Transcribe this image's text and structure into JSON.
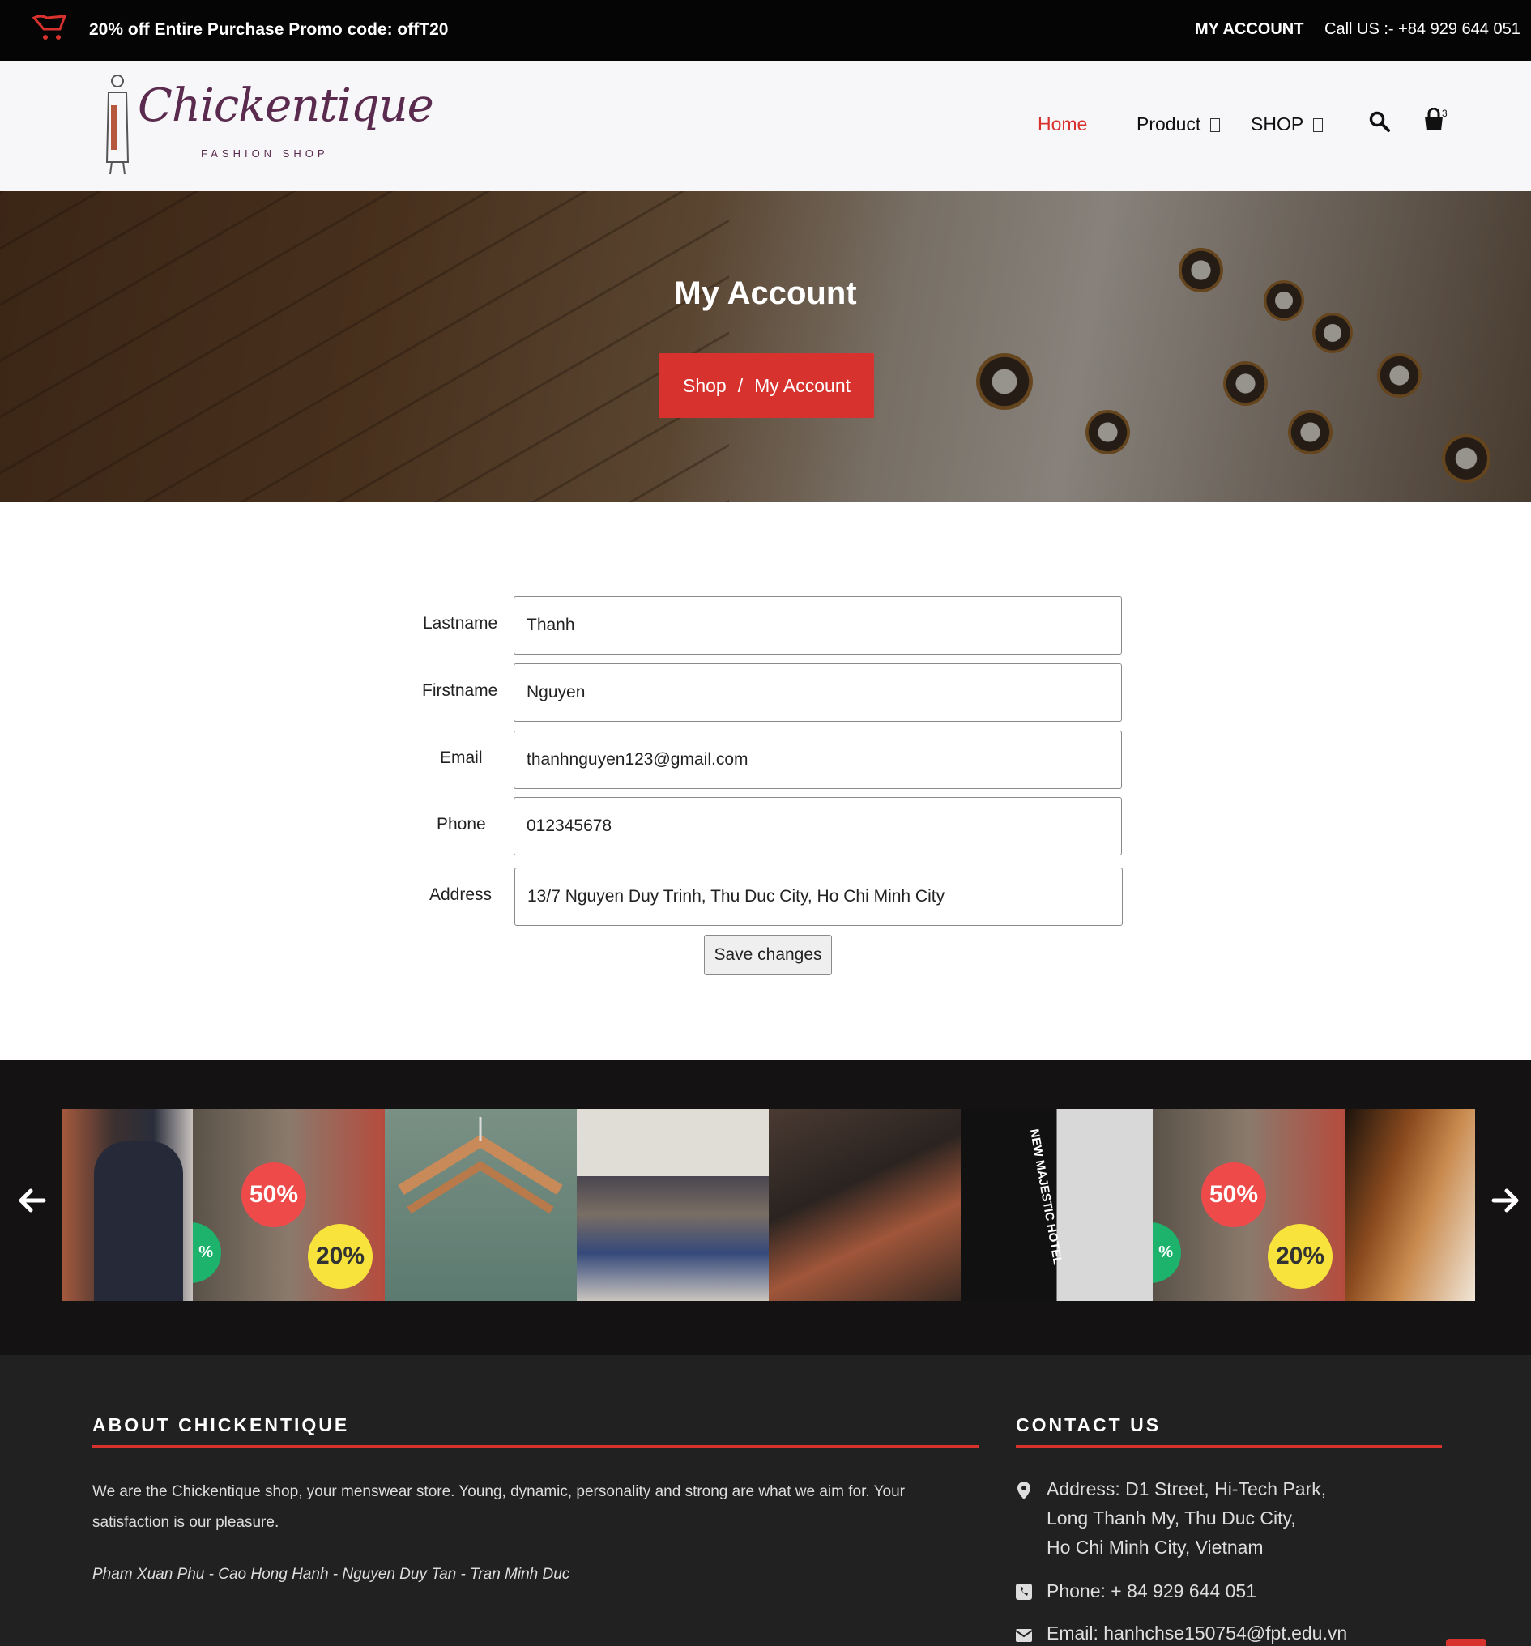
{
  "topbar": {
    "promo": "20% off Entire Purchase Promo code: offT20",
    "my_account": "MY ACCOUNT",
    "call": "Call US :- +84 929 644 051"
  },
  "header": {
    "logo_text": "Chickentique",
    "logo_sub": "FASHION SHOP",
    "nav": {
      "home": "Home",
      "product": "Product",
      "shop": "SHOP"
    },
    "cart_count": "3"
  },
  "banner": {
    "title": "My Account",
    "breadcrumb": {
      "shop": "Shop",
      "separator": "/",
      "current": "My Account"
    }
  },
  "form": {
    "lastname": {
      "label": "Lastname",
      "value": "Thanh"
    },
    "firstname": {
      "label": "Firstname",
      "value": "Nguyen"
    },
    "email": {
      "label": "Email",
      "value": "thanhnguyen123@gmail.com"
    },
    "phone": {
      "label": "Phone",
      "value": "012345678"
    },
    "address": {
      "label": "Address",
      "value": "13/7 Nguyen Duy Trinh, Thu Duc City, Ho Chi Minh City"
    },
    "save_label": "Save changes"
  },
  "carousel": {
    "badge_50": "50%",
    "badge_20": "20%",
    "badge_partial": "%",
    "bag_text": "NEW MAJESTIC HOTEL"
  },
  "footer": {
    "about_title": "ABOUT CHICKENTIQUE",
    "about_text": "We are the Chickentique shop, your menswear store. Young, dynamic, personality and strong are what we aim for. Your satisfaction is our pleasure.",
    "team": "Pham Xuan Phu - Cao Hong Hanh - Nguyen Duy Tan - Tran Minh Duc",
    "contact_title": "CONTACT US",
    "address_line1": "Address: D1 Street, Hi-Tech Park,",
    "address_line2": "Long Thanh My, Thu Duc City,",
    "address_line3": "Ho Chi Minh City, Vietnam",
    "phone": "Phone: + 84 929 644 051",
    "email": "Email: hanhchse150754@fpt.edu.vn"
  },
  "colors": {
    "accent": "#d8322e",
    "topbar_bg": "#050505",
    "footer_bg": "#212121"
  },
  "icons": [
    "shopping-cart-icon",
    "search-icon",
    "shopping-bag-icon",
    "arrow-left-icon",
    "arrow-right-icon",
    "map-marker-icon",
    "phone-square-icon",
    "envelope-icon"
  ]
}
